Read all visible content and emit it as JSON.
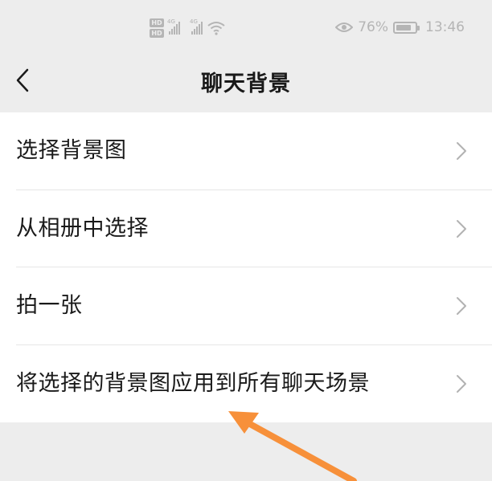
{
  "status_bar": {
    "hd1": "HD",
    "hd2": "HD",
    "net1": "4G",
    "net2": "4G",
    "battery_percent": "76%",
    "time": "13:46",
    "icons": [
      "eye-icon",
      "wifi-icon",
      "battery-icon"
    ]
  },
  "header": {
    "title": "聊天背景",
    "back_icon": "chevron-left-icon"
  },
  "menu": {
    "items": [
      {
        "label": "选择背景图"
      },
      {
        "label": "从相册中选择"
      },
      {
        "label": "拍一张"
      },
      {
        "label": "将选择的背景图应用到所有聊天场景"
      }
    ]
  },
  "colors": {
    "background": "#ededed",
    "list_background": "#ffffff",
    "text": "#1a1a1a",
    "chevron": "#b2b2b2",
    "annotation_arrow": "#f7903a"
  }
}
